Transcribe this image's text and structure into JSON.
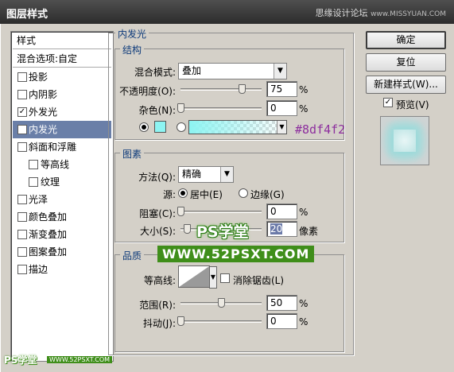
{
  "window": {
    "title": "图层样式",
    "watermark": "思缘设计论坛",
    "watermark_site": "www.MISSYUAN.COM"
  },
  "styles_list": {
    "header": "样式",
    "blend_options": "混合选项:自定",
    "items": [
      {
        "label": "投影",
        "checked": false
      },
      {
        "label": "内阴影",
        "checked": false
      },
      {
        "label": "外发光",
        "checked": true
      },
      {
        "label": "内发光",
        "checked": true,
        "selected": true
      },
      {
        "label": "斜面和浮雕",
        "checked": false
      },
      {
        "label": "等高线",
        "checked": false,
        "sub": true
      },
      {
        "label": "纹理",
        "checked": false,
        "sub": true
      },
      {
        "label": "光泽",
        "checked": false
      },
      {
        "label": "颜色叠加",
        "checked": false
      },
      {
        "label": "渐变叠加",
        "checked": false
      },
      {
        "label": "图案叠加",
        "checked": false
      },
      {
        "label": "描边",
        "checked": false
      }
    ]
  },
  "inner_glow": {
    "title": "内发光",
    "structure": {
      "title": "结构",
      "blend_mode_label": "混合模式:",
      "blend_mode": "叠加",
      "opacity_label": "不透明度(O):",
      "opacity": "75",
      "opacity_pct": 75,
      "noise_label": "杂色(N):",
      "noise": "0",
      "noise_pct": 0,
      "unit": "%",
      "color_mode": "solid",
      "color": "#8df4f2",
      "color_annotation": "#8df4f2"
    },
    "elements": {
      "title": "图素",
      "method_label": "方法(Q):",
      "method": "精确",
      "source_label": "源:",
      "source_center": "居中(E)",
      "source_edge": "边缘(G)",
      "source_selected": "center",
      "choke_label": "阻塞(C):",
      "choke": "0",
      "choke_pct": 0,
      "size_label": "大小(S):",
      "size": "20",
      "size_value": 20,
      "size_max": 250,
      "size_unit": "像素",
      "unit": "%"
    },
    "quality": {
      "title": "品质",
      "contour_label": "等高线:",
      "antialias_label": "消除锯齿(L)",
      "antialias": false,
      "range_label": "范围(R):",
      "range": "50",
      "range_pct": 50,
      "jitter_label": "抖动(J):",
      "jitter": "0",
      "jitter_pct": 0,
      "unit": "%"
    }
  },
  "buttons": {
    "ok": "确定",
    "reset": "复位",
    "new_style": "新建样式(W)...",
    "preview_label": "预览(V)",
    "preview_checked": true
  },
  "overlay_watermarks": {
    "ps_xuetang": "PS学堂",
    "site": "WWW.52PSXT.COM",
    "corner_brand": "PS学堂",
    "corner_site": "WWW.52PSXT.COM"
  }
}
